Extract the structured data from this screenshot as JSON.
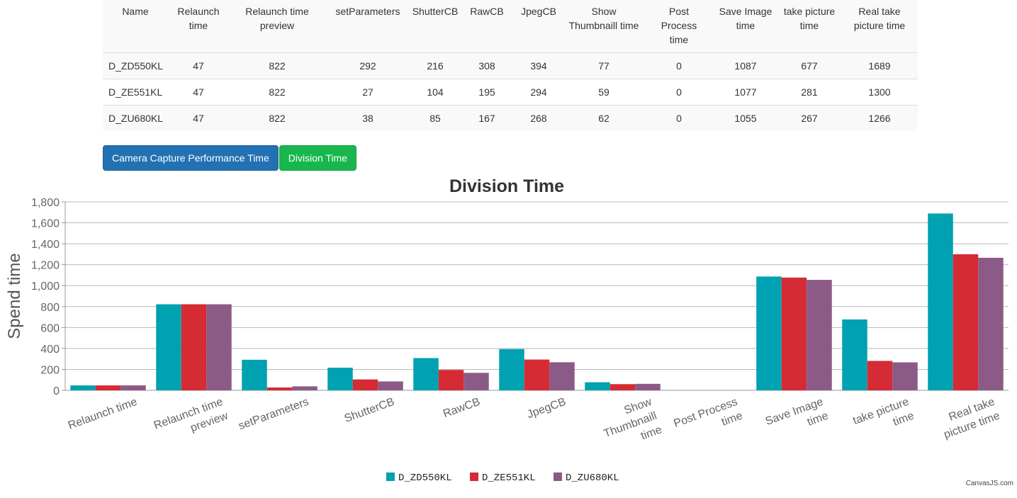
{
  "table": {
    "headers": [
      "Name",
      "Relaunch time",
      "Relaunch time preview",
      "setParameters",
      "ShutterCB",
      "RawCB",
      "JpegCB",
      "Show Thumbnaill time",
      "Post Process time",
      "Save Image time",
      "take picture time",
      "Real take picture time"
    ],
    "header_lines": [
      [
        "Name"
      ],
      [
        "Relaunch",
        "time"
      ],
      [
        "Relaunch time",
        "preview"
      ],
      [
        "setParameters"
      ],
      [
        "ShutterCB"
      ],
      [
        "RawCB"
      ],
      [
        "JpegCB"
      ],
      [
        "Show",
        "Thumbnaill time"
      ],
      [
        "Post",
        "Process",
        "time"
      ],
      [
        "Save Image",
        "time"
      ],
      [
        "take picture",
        "time"
      ],
      [
        "Real take",
        "picture time"
      ]
    ],
    "rows": [
      [
        "D_ZD550KL",
        "47",
        "822",
        "292",
        "216",
        "308",
        "394",
        "77",
        "0",
        "1087",
        "677",
        "1689"
      ],
      [
        "D_ZE551KL",
        "47",
        "822",
        "27",
        "104",
        "195",
        "294",
        "59",
        "0",
        "1077",
        "281",
        "1300"
      ],
      [
        "D_ZU680KL",
        "47",
        "822",
        "38",
        "85",
        "167",
        "268",
        "62",
        "0",
        "1055",
        "267",
        "1266"
      ]
    ]
  },
  "buttons": {
    "performance": "Camera Capture Performance Time",
    "division": "Division Time"
  },
  "credit": "CanvasJS.com",
  "chart_data": {
    "type": "bar",
    "title": "Division Time",
    "xlabel": "",
    "ylabel": "Spend time",
    "ylim": [
      0,
      1800
    ],
    "ytick_step": 200,
    "grid": true,
    "legend_position": "bottom",
    "categories": [
      "Relaunch time",
      "Relaunch time preview",
      "setParameters",
      "ShutterCB",
      "RawCB",
      "JpegCB",
      "Show Thumbnaill time",
      "Post Process time",
      "Save Image time",
      "take picture time",
      "Real take picture time"
    ],
    "category_lines": [
      [
        "Relaunch time"
      ],
      [
        "Relaunch time",
        "preview"
      ],
      [
        "setParameters"
      ],
      [
        "ShutterCB"
      ],
      [
        "RawCB"
      ],
      [
        "JpegCB"
      ],
      [
        "Show",
        "Thumbnaill",
        "time"
      ],
      [
        "Post Process",
        "time"
      ],
      [
        "Save Image",
        "time"
      ],
      [
        "take picture",
        "time"
      ],
      [
        "Real take",
        "picture time"
      ]
    ],
    "series": [
      {
        "name": "D_ZD550KL",
        "color": "#00a1b0",
        "values": [
          47,
          822,
          292,
          216,
          308,
          394,
          77,
          0,
          1087,
          677,
          1689
        ]
      },
      {
        "name": "D_ZE551KL",
        "color": "#d52b35",
        "values": [
          47,
          822,
          27,
          104,
          195,
          294,
          59,
          0,
          1077,
          281,
          1300
        ]
      },
      {
        "name": "D_ZU680KL",
        "color": "#8c5a86",
        "values": [
          47,
          822,
          38,
          85,
          167,
          268,
          62,
          0,
          1055,
          267,
          1266
        ]
      }
    ]
  }
}
